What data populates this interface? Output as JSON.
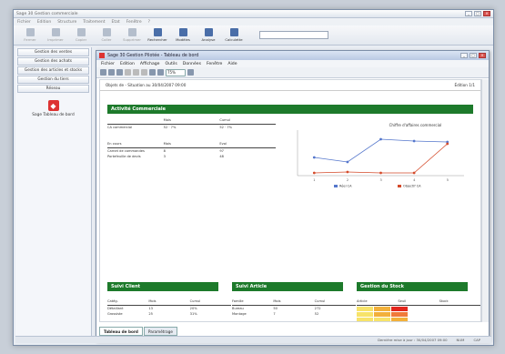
{
  "app": {
    "title": "Sage 30 Gestion commerciale",
    "menu": [
      "Fichier",
      "Edition",
      "Structure",
      "Traitement",
      "Etat",
      "Fenêtre",
      "?"
    ],
    "toolbar": [
      {
        "label": "Fermer",
        "icon": "close-doc-icon",
        "enabled": false
      },
      {
        "label": "Imprimer",
        "icon": "printer-icon",
        "enabled": false
      },
      {
        "label": "Copier",
        "icon": "copy-icon",
        "enabled": false
      },
      {
        "label": "Coller",
        "icon": "paste-icon",
        "enabled": false
      },
      {
        "label": "Supprimer",
        "icon": "delete-icon",
        "enabled": false
      },
      {
        "label": "Rechercher",
        "icon": "search-icon",
        "enabled": true
      },
      {
        "label": "Modèles",
        "icon": "template-icon",
        "enabled": true
      },
      {
        "label": "Analyse",
        "icon": "chart-icon",
        "enabled": true
      },
      {
        "label": "Calculette",
        "icon": "calculator-icon",
        "enabled": true
      }
    ]
  },
  "sidebar": {
    "items": [
      "Gestion des ventes",
      "Gestion des achats",
      "Gestion des articles et stocks",
      "Gestion du tiers",
      "Réseau"
    ],
    "shortcut": "Sage Tableau de bord"
  },
  "child": {
    "title": "Sage 30 Gestion Pilotée - Tableau de bord",
    "menu": [
      "Fichier",
      "Edition",
      "Affichage",
      "Outils",
      "Données",
      "Fenêtre",
      "Aide"
    ],
    "zoom": "75%",
    "doc_header_left": "Objets de - Situation au 30/04/2007 09:00",
    "doc_header_right": "Édition 1/1",
    "sections": {
      "commerce": "Activité Commerciale",
      "client": "Suivi Client",
      "article": "Suivi Article",
      "stock": "Gestion du Stock"
    },
    "chart_title": "Chiffre d'affaires commercial",
    "legend": [
      "Réel CA",
      "Objectif CA"
    ],
    "tabs": [
      "Tableau de bord",
      "Paramétrage"
    ],
    "status": [
      "Dernière mise à jour : 30/04/2007 09:00",
      "NUM",
      "CAP"
    ]
  },
  "colors": {
    "accent": "#1d7a2b",
    "series_blue": "#5577cc",
    "series_red": "#d44a2a"
  },
  "chart_data": {
    "type": "line",
    "categories": [
      "1",
      "2",
      "3",
      "4",
      "5"
    ],
    "series": [
      {
        "name": "Réel CA",
        "values": [
          20,
          15,
          40,
          38,
          37
        ]
      },
      {
        "name": "Objectif CA",
        "values": [
          3,
          4,
          3,
          3,
          35
        ]
      }
    ],
    "title": "Chiffre d'affaires commercial",
    "ylim": [
      0,
      50
    ]
  }
}
